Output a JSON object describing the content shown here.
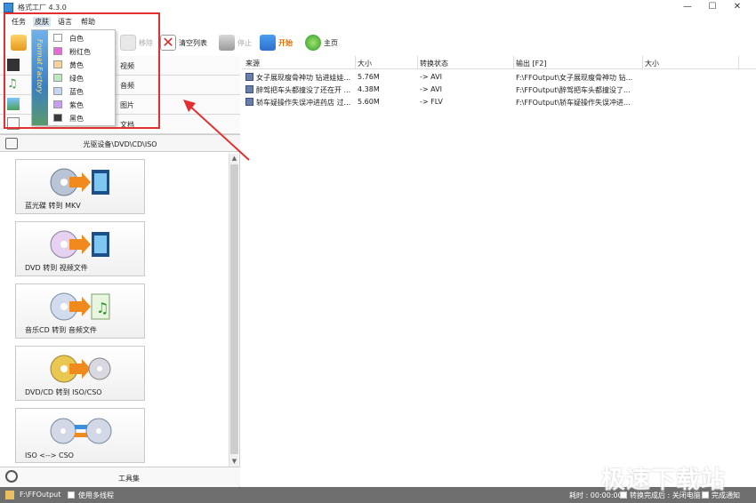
{
  "window": {
    "title": "格式工厂 4.3.0",
    "minimize": "—",
    "maximize": "☐",
    "close": "✕"
  },
  "menu": {
    "items": [
      "任务",
      "皮肤",
      "语言",
      "帮助"
    ]
  },
  "toolbar": {
    "remove_label": "移除",
    "clear_label": "清空列表",
    "stop_label": "停止",
    "start_label": "开始",
    "home_label": "主页"
  },
  "categories": [
    "视频",
    "音频",
    "图片",
    "文档"
  ],
  "optical": {
    "header": "光驱设备\\DVD\\CD\\ISO"
  },
  "tiles": [
    {
      "label": "蓝光碟 转到 MKV"
    },
    {
      "label": "DVD 转到 视频文件"
    },
    {
      "label": "音乐CD 转到 音频文件"
    },
    {
      "label": "DVD/CD 转到 ISO/CSO"
    },
    {
      "label": "ISO <--> CSO"
    }
  ],
  "toolset_label": "工具集",
  "file_list": {
    "columns": [
      "来源",
      "大小",
      "转换状态",
      "输出 [F2]",
      "大小"
    ],
    "rows": [
      {
        "source": "女子展现瘦骨神功 钻进娃娃...",
        "size": "5.76M",
        "status": "-> AVI",
        "output": "F:\\FFOutput\\女子展现瘦骨神功 钻..."
      },
      {
        "source": "醉驾把车头都撞没了还在开 ...",
        "size": "4.38M",
        "status": "-> AVI",
        "output": "F:\\FFOutput\\醉驾把车头都撞没了..."
      },
      {
        "source": "轿车疑操作失误冲进药店 过...",
        "size": "5.60M",
        "status": "-> FLV",
        "output": "F:\\FFOutput\\轿车疑操作失误冲进..."
      }
    ]
  },
  "skin_menu": {
    "banner": "Format Factory",
    "items": [
      {
        "label": "白色",
        "color": "#ffffff"
      },
      {
        "label": "粉红色",
        "color": "#e86ad8"
      },
      {
        "label": "黄色",
        "color": "#f6d49a"
      },
      {
        "label": "绿色",
        "color": "#bfe8c0"
      },
      {
        "label": "蓝色",
        "color": "#c3d8f0"
      },
      {
        "label": "紫色",
        "color": "#c89cf0"
      },
      {
        "label": "黑色",
        "color": "#3a3a3a"
      }
    ]
  },
  "status": {
    "output_path": "F:\\FFOutput",
    "multithread": "使用多线程",
    "elapsed": "耗时 : 00:00:00",
    "after_done": "转换完成后 : 关闭电脑",
    "notify": "完成通知"
  },
  "watermark": "极速下载站"
}
